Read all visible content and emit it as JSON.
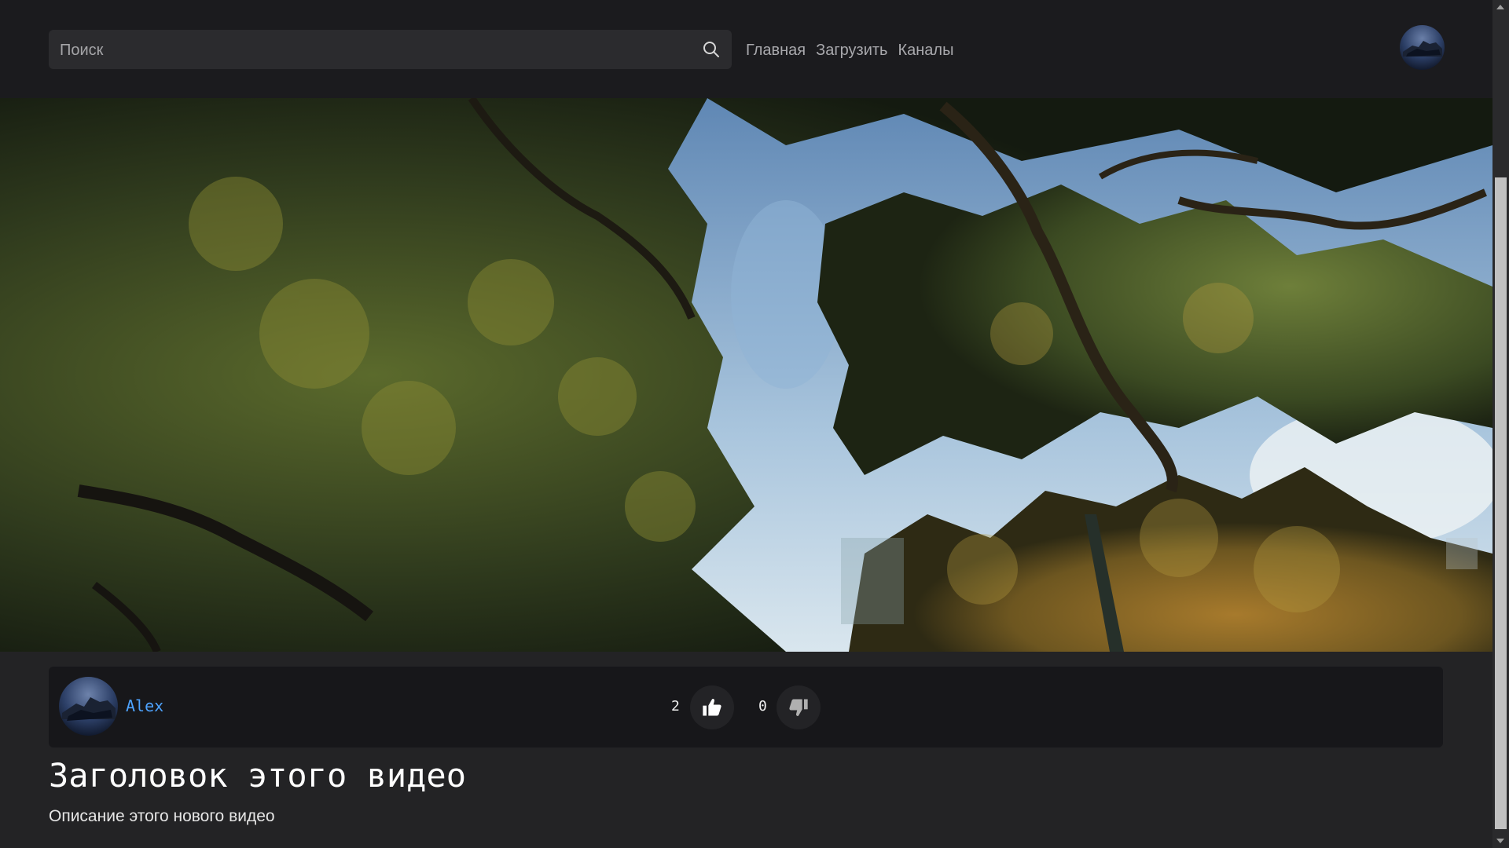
{
  "header": {
    "search": {
      "placeholder": "Поиск",
      "value": ""
    },
    "nav": [
      {
        "label": "Главная"
      },
      {
        "label": "Загрузить"
      },
      {
        "label": "Каналы"
      }
    ]
  },
  "video": {
    "channel_name": "Alex",
    "likes": "2",
    "dislikes": "0",
    "title": "Заголовок этого видео",
    "description": "Описание этого нового видео"
  },
  "icons": {
    "search": "search-icon",
    "like": "thumbs-up-icon",
    "dislike": "thumbs-down-icon"
  },
  "colors": {
    "background": "#232325",
    "header": "#1b1b1e",
    "info_bar": "#17171a",
    "channel_link": "#4ea3ff"
  }
}
